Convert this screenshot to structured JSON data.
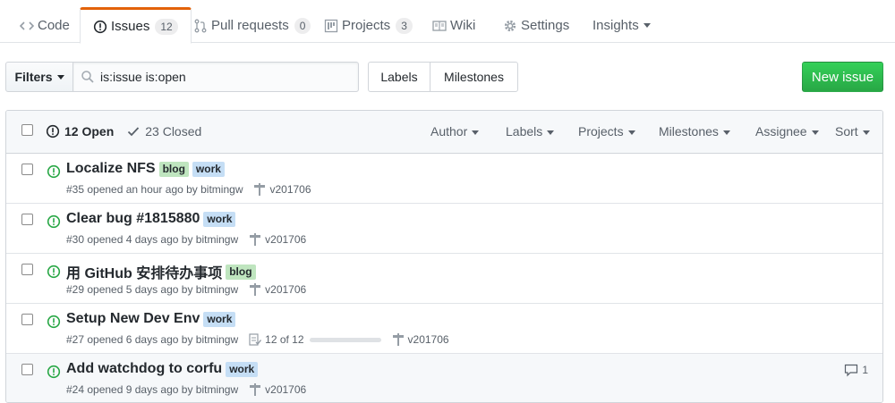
{
  "nav": {
    "tabs": [
      {
        "label": "Code",
        "icon": "code-icon"
      },
      {
        "label": "Issues",
        "icon": "issue-opened-icon",
        "count": "12",
        "selected": true
      },
      {
        "label": "Pull requests",
        "icon": "git-pull-request-icon",
        "count": "0"
      },
      {
        "label": "Projects",
        "icon": "project-icon",
        "count": "3"
      },
      {
        "label": "Wiki",
        "icon": "book-icon"
      },
      {
        "label": "Settings",
        "icon": "gear-icon"
      },
      {
        "label": "Insights",
        "icon": "chevron-down-icon"
      }
    ]
  },
  "subnav": {
    "filters_label": "Filters",
    "search_value": "is:issue is:open",
    "labels_label": "Labels",
    "milestones_label": "Milestones",
    "new_issue_label": "New issue"
  },
  "header": {
    "open_label": "12 Open",
    "closed_label": "23 Closed",
    "filters": [
      "Author",
      "Labels",
      "Projects",
      "Milestones",
      "Assignee",
      "Sort"
    ]
  },
  "issues": [
    {
      "title": "Localize NFS",
      "labels": [
        "blog",
        "work"
      ],
      "meta": "#35 opened an hour ago by bitmingw",
      "milestone": "v201706"
    },
    {
      "title": "Clear bug #1815880",
      "labels": [
        "work"
      ],
      "meta": "#30 opened 4 days ago by bitmingw",
      "milestone": "v201706"
    },
    {
      "title": "用 GitHub 安排待办事项",
      "labels": [
        "blog"
      ],
      "meta": "#29 opened 5 days ago by bitmingw",
      "milestone": "v201706"
    },
    {
      "title": "Setup New Dev Env",
      "labels": [
        "work"
      ],
      "meta": "#27 opened 6 days ago by bitmingw",
      "tasks": "12 of 12",
      "tasks_fraction": 1.0,
      "milestone": "v201706"
    },
    {
      "title": "Add watchdog to corfu",
      "labels": [
        "work"
      ],
      "meta": "#24 opened 9 days ago by bitmingw",
      "milestone": "v201706",
      "comments": "1"
    }
  ],
  "colors": {
    "accent_tab": "#e36209",
    "new_issue_green": "#28a745",
    "open_icon_green": "#28a745",
    "label_blog": "#bfe5bf",
    "label_work": "#c5def5"
  }
}
